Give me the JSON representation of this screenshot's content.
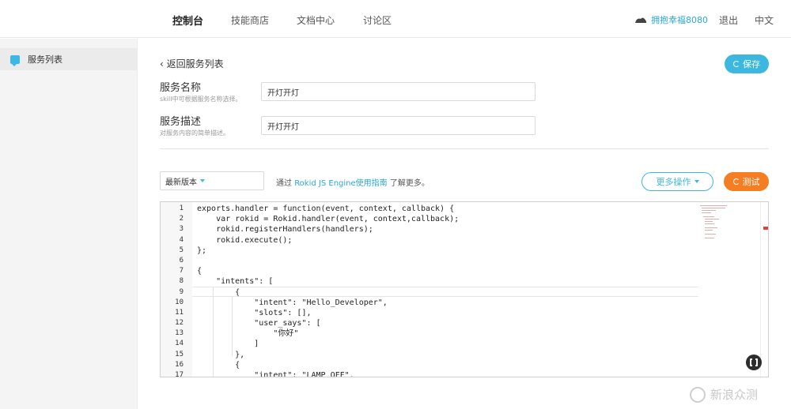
{
  "nav": {
    "items": [
      {
        "label": "控制台"
      },
      {
        "label": "技能商店"
      },
      {
        "label": "文档中心"
      },
      {
        "label": "讨论区"
      }
    ],
    "username": "拥抱幸福8080",
    "logout": "退出",
    "language": "中文"
  },
  "sidebar": {
    "items": [
      {
        "label": "服务列表"
      }
    ]
  },
  "main": {
    "back_label": "返回服务列表",
    "save_label": "保存",
    "service_name": {
      "label": "服务名称",
      "hint": "skill中可根据服务名称选择。",
      "value": "开灯开灯"
    },
    "service_desc": {
      "label": "服务描述",
      "hint": "对服务内容的简单描述。",
      "value": "开灯开灯"
    },
    "version_select": "最新版本",
    "info_prefix": "通过",
    "info_link": "Rokid JS Engine使用指南",
    "info_suffix": "了解更多。",
    "more_actions": "更多操作",
    "test_label": "测试"
  },
  "editor": {
    "lines": [
      {
        "n": "1",
        "text": "exports.handler = function(event, context, callback) {"
      },
      {
        "n": "2",
        "text": "    var rokid = Rokid.handler(event, context,callback);"
      },
      {
        "n": "3",
        "text": "    rokid.registerHandlers(handlers);"
      },
      {
        "n": "4",
        "text": "    rokid.execute();"
      },
      {
        "n": "5",
        "text": "};"
      },
      {
        "n": "6",
        "text": ""
      },
      {
        "n": "7",
        "text": "{"
      },
      {
        "n": "8",
        "text": "    \"intents\": ["
      },
      {
        "n": "9",
        "text": "        {"
      },
      {
        "n": "10",
        "text": "            \"intent\": \"Hello_Developer\","
      },
      {
        "n": "11",
        "text": "            \"slots\": [],"
      },
      {
        "n": "12",
        "text": "            \"user_says\": ["
      },
      {
        "n": "13",
        "text": "                \"你好\""
      },
      {
        "n": "14",
        "text": "            ]"
      },
      {
        "n": "15",
        "text": "        },"
      },
      {
        "n": "16",
        "text": "        {"
      },
      {
        "n": "17",
        "text": "            \"intent\": \"LAMP_OFF\","
      }
    ]
  },
  "watermark": "新浪众测",
  "colors": {
    "accent": "#3cb8e0",
    "test": "#f57e22",
    "link": "#2aa8d8"
  }
}
